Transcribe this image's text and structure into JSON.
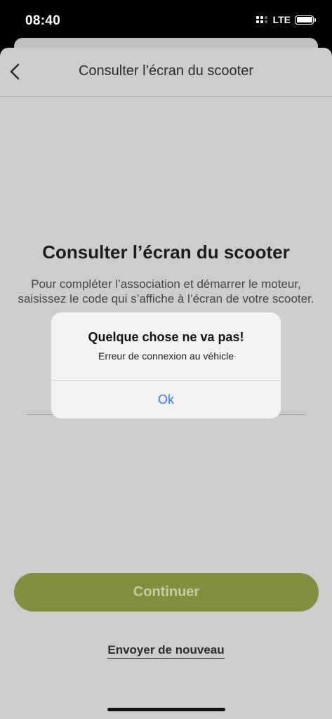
{
  "status_bar": {
    "time": "08:40",
    "network": "LTE",
    "icons": [
      "signal-icon",
      "battery-icon"
    ]
  },
  "nav": {
    "title": "Consulter l’écran du scooter",
    "back_icon": "chevron-left-icon"
  },
  "main": {
    "title": "Consulter l’écran du scooter",
    "description": "Pour compléter l’association et démarrer le moteur, saisissez le code qui s’affiche à l’écran de votre scooter."
  },
  "actions": {
    "continue_label": "Continuer",
    "resend_label": "Envoyer de nouveau"
  },
  "alert": {
    "title": "Quelque chose ne va pas!",
    "message": "Erreur de connexion au véhicle",
    "ok_label": "Ok"
  },
  "colors": {
    "accent": "#838f3d",
    "link_blue": "#2f7cf6",
    "overlay_background": "#cdcdcd"
  }
}
